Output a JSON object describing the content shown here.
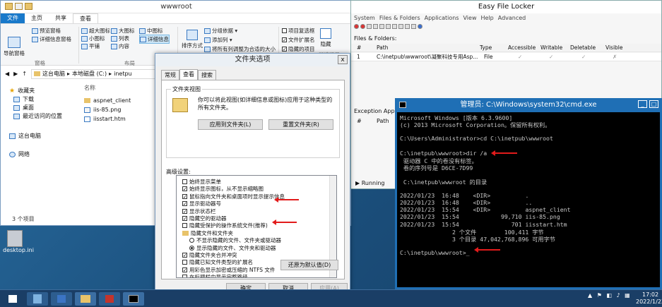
{
  "explorer": {
    "title": "wwwroot",
    "tabs": [
      "文件",
      "主页",
      "共享",
      "查看"
    ],
    "ribbon": {
      "preview_pane": "预览窗格",
      "details_pane": "详细信息窗格",
      "nav_pane": "导航窗格",
      "xl_icons": "超大图标",
      "large_icons": "大图标",
      "medium_icons": "中图标",
      "small_icons": "小图标",
      "list": "列表",
      "details": "详细信息",
      "tiles": "平铺",
      "content": "内容",
      "sort_by": "排序方式",
      "group_by": "分组依据 ▾",
      "add_column": "添加列 ▾",
      "fit_columns": "将所有列调整为合适的大小",
      "item_checkboxes": "项目复选框",
      "file_ext": "文件扩展名",
      "hidden_items": "隐藏的项目",
      "hide_selected": "隐藏",
      "selected_items": "所选项目",
      "group_panes": "窗格",
      "group_layout": "布局"
    },
    "address": [
      "这台电脑",
      "本地磁盘 (C:)",
      "inetpu"
    ],
    "nav": {
      "favorites": "收藏夹",
      "downloads": "下载",
      "desktop": "桌面",
      "recent": "最近访问的位置",
      "this_pc": "这台电脑",
      "network": "网络"
    },
    "column_name": "名称",
    "files": [
      "aspnet_client",
      "iis-85.png",
      "iisstart.htm"
    ],
    "status": "3 个项目"
  },
  "dialog": {
    "title": "文件夹选项",
    "close": "x",
    "tabs": [
      "常规",
      "查看",
      "搜索"
    ],
    "folder_views": "文件夹视图",
    "folder_views_desc": "你可以将此视图(如详细信息或图标)应用于这种类型的所有文件夹。",
    "apply_btn": "应用到文件夹(L)",
    "reset_btn": "重置文件夹(R)",
    "advanced": "高级设置:",
    "settings": [
      {
        "label": "始终显示菜单",
        "type": "cb",
        "checked": false
      },
      {
        "label": "始终显示图标，从不显示缩略图",
        "type": "cb",
        "checked": true
      },
      {
        "label": "鼠标指向文件夹和桌面项时显示提示信息",
        "type": "cb",
        "checked": true
      },
      {
        "label": "显示驱动器号",
        "type": "cb",
        "checked": true
      },
      {
        "label": "显示状态栏",
        "type": "cb",
        "checked": true
      },
      {
        "label": "隐藏空的驱动器",
        "type": "cb",
        "checked": true
      },
      {
        "label": "隐藏受保护的操作系统文件(推荐)",
        "type": "cb",
        "checked": false
      },
      {
        "label": "隐藏文件和文件夹",
        "type": "folder",
        "checked": false
      },
      {
        "label": "不显示隐藏的文件、文件夹或驱动器",
        "type": "rd",
        "checked": false
      },
      {
        "label": "显示隐藏的文件、文件夹和驱动器",
        "type": "rd",
        "checked": true
      },
      {
        "label": "隐藏文件夹合并冲突",
        "type": "cb",
        "checked": true
      },
      {
        "label": "隐藏已知文件类型的扩展名",
        "type": "cb",
        "checked": false
      },
      {
        "label": "用彩色显示加密或压缩的 NTFS 文件",
        "type": "cb",
        "checked": true
      },
      {
        "label": "在标题栏中显示完整路径",
        "type": "cb",
        "checked": false
      }
    ],
    "restore_btn": "还原为默认值(D)",
    "ok_btn": "确定",
    "cancel_btn": "取消",
    "apply_footer_btn": "应用(A)"
  },
  "efl": {
    "title": "Easy File Locker",
    "menu": [
      "System",
      "Files & Folders",
      "Applications",
      "View",
      "Help",
      "Advanced"
    ],
    "files_header": "Files & Folders:",
    "columns": [
      "#",
      "Path",
      "Type",
      "Accessible",
      "Writable",
      "Deletable",
      "Visible"
    ],
    "row": {
      "num": "1",
      "path": "C:\\inetpub\\wwwroot\\凝聚科技专用Asp...",
      "type": "File",
      "accessible": "✓",
      "writable": "✓",
      "deletable": "✓",
      "visible": "✗"
    },
    "exc_header": "Exception Applic",
    "exc_cols": [
      "#",
      "Path"
    ],
    "running": "Running"
  },
  "cmd": {
    "title": "管理员: C:\\Windows\\system32\\cmd.exe",
    "lines": [
      "Microsoft Windows [版本 6.3.9600]",
      "(c) 2013 Microsoft Corporation。保留所有权利。",
      "",
      "C:\\Users\\Administrator>cd C:\\inetpub\\wwwroot",
      "",
      "C:\\inetpub\\wwwroot>dir /a",
      " 驱动器 C 中的卷没有标签。",
      " 卷的序列号是 D6CE-7D99",
      "",
      " C:\\inetpub\\wwwroot 的目录",
      "",
      "2022/01/23  16:48    <DIR>          .",
      "2022/01/23  16:48    <DIR>          ..",
      "2022/01/23  15:54    <DIR>          aspnet_client",
      "2022/01/23  15:54            99,710 iis-85.png",
      "2022/01/23  15:54               701 iisstart.htm",
      "               2 个文件        100,411 字节",
      "               3 个目录 47,042,768,896 可用字节",
      "",
      "C:\\inetpub\\wwwroot>_"
    ]
  },
  "desktop": {
    "icon_label": "desktop.ini"
  },
  "taskbar": {
    "time": "17:02",
    "date": "2022/1/23",
    "tray_icons": "▲ ⚑ ◧ ♪ ▦"
  }
}
